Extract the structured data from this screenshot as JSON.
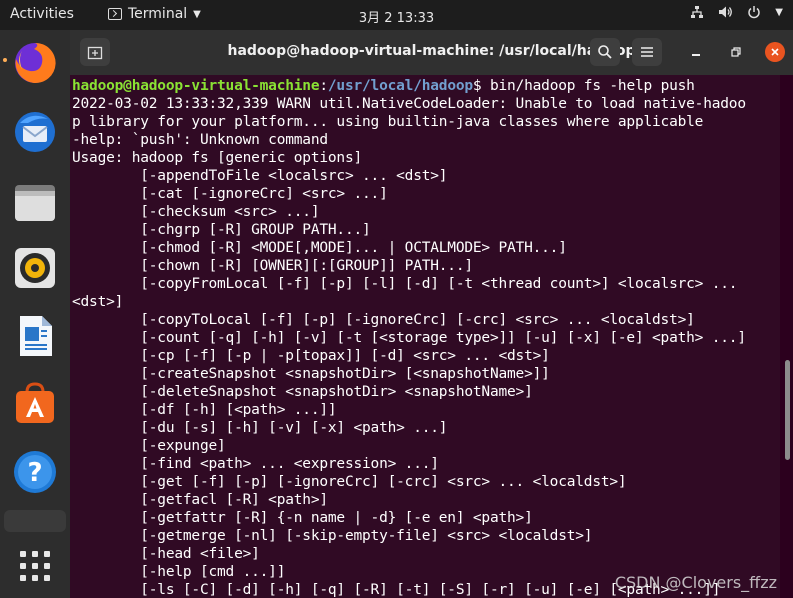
{
  "topbar": {
    "activities": "Activities",
    "app_name": "Terminal",
    "clock": "3月 2  13:33"
  },
  "window": {
    "title": "hadoop@hadoop-virtual-machine: /usr/local/hadoop"
  },
  "dock": {
    "items": [
      "firefox-icon",
      "thunderbird-icon",
      "files-icon",
      "rhythmbox-icon",
      "libreoffice-writer-icon",
      "software-icon",
      "help-icon",
      "show-apps-icon"
    ]
  },
  "terminal": {
    "prompt_user": "hadoop@hadoop-virtual-machine",
    "prompt_sep": ":",
    "prompt_path": "/usr/local/hadoop",
    "prompt_end": "$ ",
    "command": "bin/hadoop fs -help push",
    "lines": [
      "2022-03-02 13:33:32,339 WARN util.NativeCodeLoader: Unable to load native-hadoo",
      "p library for your platform... using builtin-java classes where applicable",
      "-help: `push': Unknown command",
      "Usage: hadoop fs [generic options]",
      "        [-appendToFile <localsrc> ... <dst>]",
      "        [-cat [-ignoreCrc] <src> ...]",
      "        [-checksum <src> ...]",
      "        [-chgrp [-R] GROUP PATH...]",
      "        [-chmod [-R] <MODE[,MODE]... | OCTALMODE> PATH...]",
      "        [-chown [-R] [OWNER][:[GROUP]] PATH...]",
      "        [-copyFromLocal [-f] [-p] [-l] [-d] [-t <thread count>] <localsrc> ...",
      "<dst>]",
      "        [-copyToLocal [-f] [-p] [-ignoreCrc] [-crc] <src> ... <localdst>]",
      "        [-count [-q] [-h] [-v] [-t [<storage type>]] [-u] [-x] [-e] <path> ...]",
      "        [-cp [-f] [-p | -p[topax]] [-d] <src> ... <dst>]",
      "        [-createSnapshot <snapshotDir> [<snapshotName>]]",
      "        [-deleteSnapshot <snapshotDir> <snapshotName>]",
      "        [-df [-h] [<path> ...]]",
      "        [-du [-s] [-h] [-v] [-x] <path> ...]",
      "        [-expunge]",
      "        [-find <path> ... <expression> ...]",
      "        [-get [-f] [-p] [-ignoreCrc] [-crc] <src> ... <localdst>]",
      "        [-getfacl [-R] <path>]",
      "        [-getfattr [-R] {-n name | -d} [-e en] <path>]",
      "        [-getmerge [-nl] [-skip-empty-file] <src> <localdst>]",
      "        [-head <file>]",
      "        [-help [cmd ...]]",
      "        [-ls [-C] [-d] [-h] [-q] [-R] [-t] [-S] [-r] [-u] [-e] [<path> ...]]"
    ]
  },
  "watermark": "CSDN @Clovers_ffzz"
}
